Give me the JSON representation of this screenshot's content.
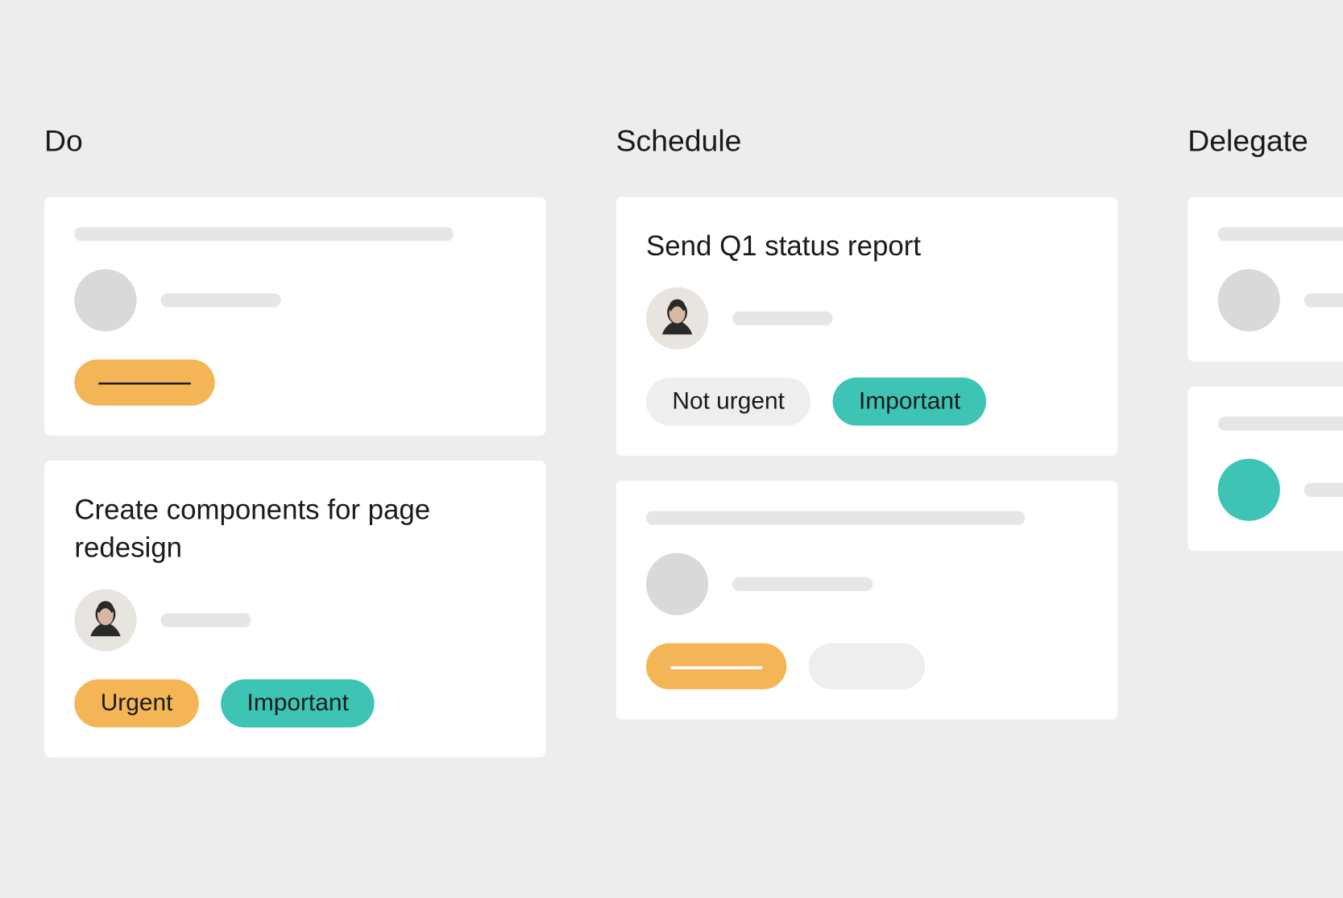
{
  "columns": {
    "do": {
      "title": "Do",
      "cards": [
        {
          "placeholder": true
        },
        {
          "title": "Create components for page redesign",
          "tags": [
            {
              "label": "Urgent",
              "color": "orange"
            },
            {
              "label": "Important",
              "color": "teal"
            }
          ]
        }
      ]
    },
    "schedule": {
      "title": "Schedule",
      "cards": [
        {
          "title": "Send Q1 status report",
          "tags": [
            {
              "label": "Not urgent",
              "color": "grey"
            },
            {
              "label": "Important",
              "color": "teal"
            }
          ]
        },
        {
          "placeholder": true
        }
      ]
    },
    "delegate": {
      "title": "Delegate",
      "cards": [
        {
          "placeholder": true
        },
        {
          "placeholder": true,
          "avatar_color": "teal"
        }
      ]
    }
  },
  "colors": {
    "orange": "#f4b556",
    "teal": "#3dc4b4",
    "grey": "#eeeeee",
    "bg": "#ededed",
    "card": "#ffffff"
  }
}
